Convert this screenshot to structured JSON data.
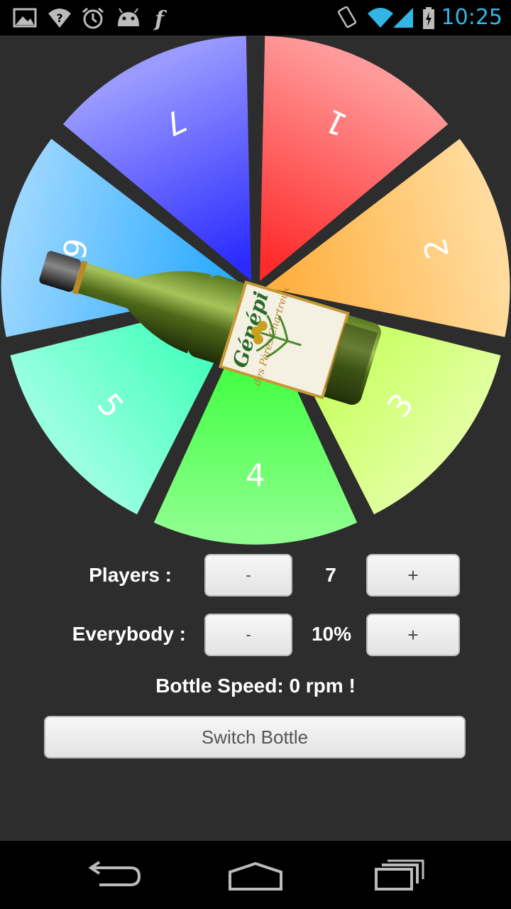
{
  "status_bar": {
    "time": "10:25",
    "left_icons": [
      "gallery-icon",
      "wifi-question-icon",
      "alarm-icon",
      "android-icon",
      "flipboard-icon"
    ],
    "right_icons": [
      "rotation-icon",
      "wifi-icon",
      "signal-icon",
      "battery-charging-icon"
    ],
    "accent": "#33b5e5"
  },
  "wheel": {
    "segments": [
      {
        "label": "1",
        "colors": [
          "#ff2a2a",
          "#ff9a9a"
        ]
      },
      {
        "label": "2",
        "colors": [
          "#ffb040",
          "#ffdc9e"
        ]
      },
      {
        "label": "3",
        "colors": [
          "#b8ff3a",
          "#e2ffa0"
        ]
      },
      {
        "label": "4",
        "colors": [
          "#2bff2b",
          "#8fff8f"
        ]
      },
      {
        "label": "5",
        "colors": [
          "#2bffb2",
          "#9affe0"
        ]
      },
      {
        "label": "6",
        "colors": [
          "#2aaaff",
          "#9ad6ff"
        ]
      },
      {
        "label": "7",
        "colors": [
          "#2a2aff",
          "#9a9aff"
        ]
      }
    ],
    "bottle": {
      "label_title": "Génépi",
      "label_subtitle": "des Pères Chartreux"
    }
  },
  "controls": {
    "players": {
      "label": "Players :",
      "value": "7",
      "minus": "-",
      "plus": "+"
    },
    "everybody": {
      "label": "Everybody :",
      "value": "10%",
      "minus": "-",
      "plus": "+"
    },
    "speed_text": "Bottle Speed: 0 rpm !",
    "switch_label": "Switch Bottle"
  },
  "nav": {
    "icons": [
      "back-icon",
      "home-icon",
      "recent-apps-icon"
    ]
  }
}
